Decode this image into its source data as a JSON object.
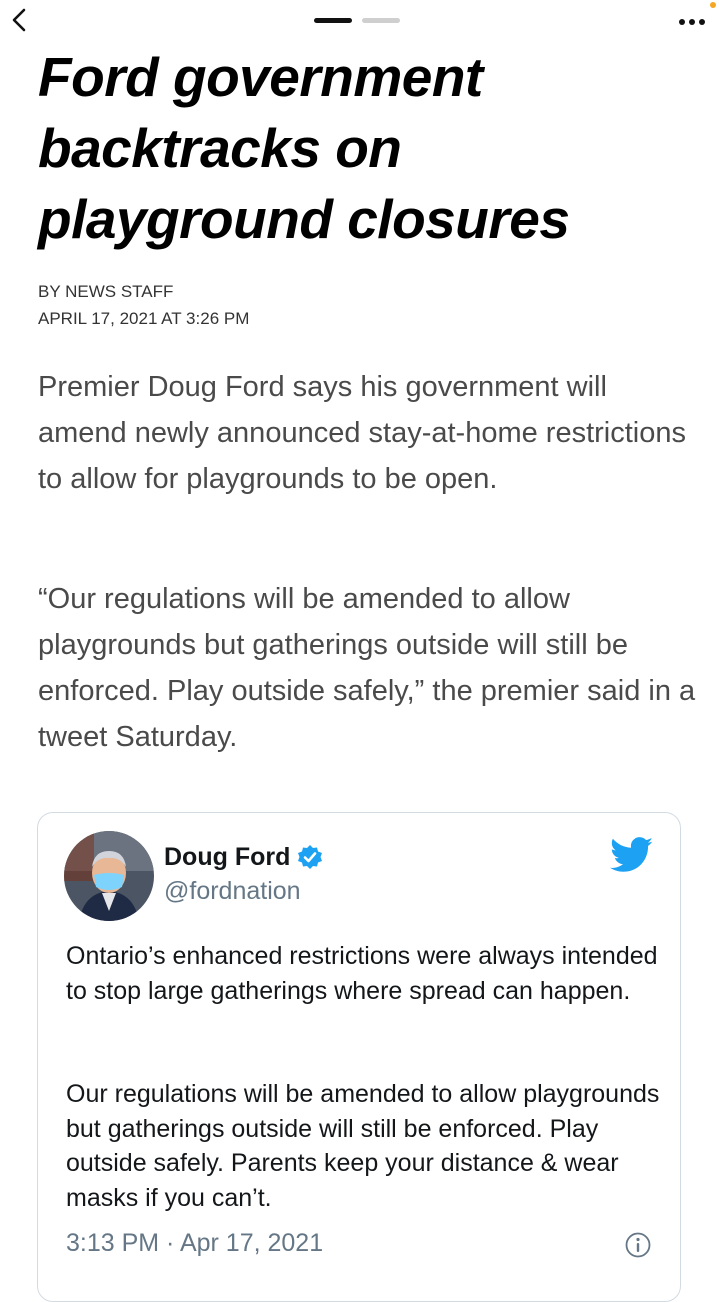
{
  "nav": {
    "back_icon": "chevron-left-icon",
    "more_icon": "more-dots-icon",
    "pages": 2,
    "active_page": 1,
    "notification_color": "#f5a623"
  },
  "article": {
    "headline": "Ford government backtracks on playground closures",
    "byline": "BY NEWS STAFF",
    "dateline": "APRIL 17, 2021 AT 3:26 PM",
    "paragraphs": [
      "Premier Doug Ford says his government will amend newly announced stay-at-home restrictions to allow for playgrounds to be open.",
      "“Our regulations will be amended to allow playgrounds but gatherings outside will still be enforced. Play outside safely,” the premier said in a tweet Saturday."
    ]
  },
  "tweet": {
    "name": "Doug Ford",
    "handle": "@fordnation",
    "verified": true,
    "text_1": "Ontario’s enhanced restrictions were always intended to stop large gatherings where spread can happen.",
    "text_2": "Our regulations will be amended to allow playgrounds but gatherings outside will still be enforced. Play outside safely. Parents keep your distance & wear masks if you can’t.",
    "timestamp": "3:13 PM · Apr 17, 2021",
    "brand_color": "#1da1f2",
    "icons": [
      "verified-badge-icon",
      "twitter-bird-icon",
      "info-icon"
    ]
  }
}
